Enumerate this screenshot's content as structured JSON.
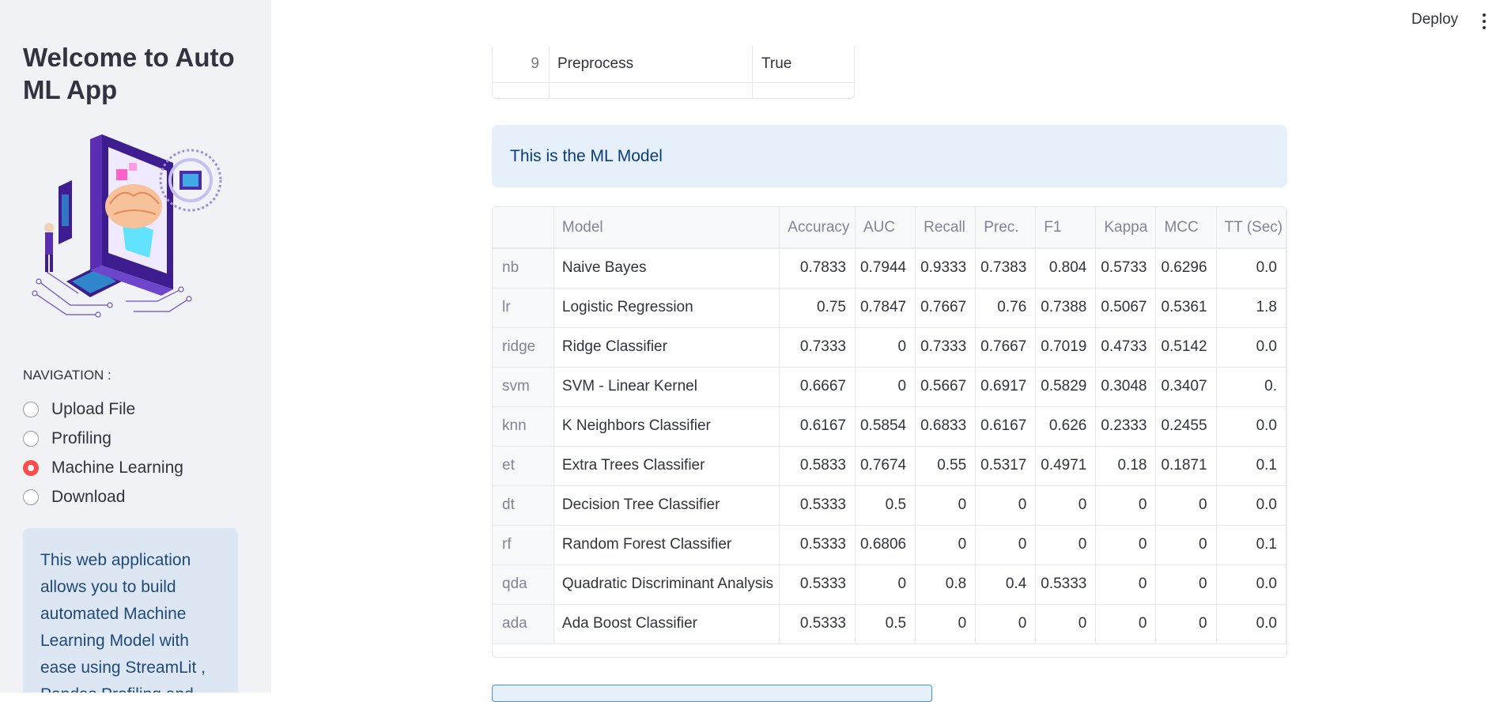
{
  "header": {
    "deploy_label": "Deploy",
    "menu_icon": "kebab-menu-icon"
  },
  "sidebar": {
    "title": "Welcome to Auto ML App",
    "nav_label": "NAVIGATION :",
    "options": [
      {
        "label": "Upload File",
        "selected": false
      },
      {
        "label": "Profiling",
        "selected": false
      },
      {
        "label": "Machine Learning",
        "selected": true
      },
      {
        "label": "Download",
        "selected": false
      }
    ],
    "info_text": "This web application allows you to build automated Machine Learning Model with ease using StreamLit , Pandas Profiling and PyCaret.",
    "accent_color": "#ff4b4b"
  },
  "setup_table": {
    "rows": [
      {
        "index": "9",
        "name": "Preprocess",
        "value": "True"
      }
    ]
  },
  "ml_banner": {
    "text": "This is the ML Model"
  },
  "model_table": {
    "columns": [
      "",
      "Model",
      "Accuracy",
      "AUC",
      "Recall",
      "Prec.",
      "F1",
      "Kappa",
      "MCC",
      "TT (Sec)"
    ],
    "rows": [
      [
        "nb",
        "Naive Bayes",
        "0.7833",
        "0.7944",
        "0.9333",
        "0.7383",
        "0.804",
        "0.5733",
        "0.6296",
        "0.0"
      ],
      [
        "lr",
        "Logistic Regression",
        "0.75",
        "0.7847",
        "0.7667",
        "0.76",
        "0.7388",
        "0.5067",
        "0.5361",
        "1.8"
      ],
      [
        "ridge",
        "Ridge Classifier",
        "0.7333",
        "0",
        "0.7333",
        "0.7667",
        "0.7019",
        "0.4733",
        "0.5142",
        "0.0"
      ],
      [
        "svm",
        "SVM - Linear Kernel",
        "0.6667",
        "0",
        "0.5667",
        "0.6917",
        "0.5829",
        "0.3048",
        "0.3407",
        "0."
      ],
      [
        "knn",
        "K Neighbors Classifier",
        "0.6167",
        "0.5854",
        "0.6833",
        "0.6167",
        "0.626",
        "0.2333",
        "0.2455",
        "0.0"
      ],
      [
        "et",
        "Extra Trees Classifier",
        "0.5833",
        "0.7674",
        "0.55",
        "0.5317",
        "0.4971",
        "0.18",
        "0.1871",
        "0.1"
      ],
      [
        "dt",
        "Decision Tree Classifier",
        "0.5333",
        "0.5",
        "0",
        "0",
        "0",
        "0",
        "0",
        "0.0"
      ],
      [
        "rf",
        "Random Forest Classifier",
        "0.5333",
        "0.6806",
        "0",
        "0",
        "0",
        "0",
        "0",
        "0.1"
      ],
      [
        "qda",
        "Quadratic Discriminant Analysis",
        "0.5333",
        "0",
        "0.8",
        "0.4",
        "0.5333",
        "0",
        "0",
        "0.0"
      ],
      [
        "ada",
        "Ada Boost Classifier",
        "0.5333",
        "0.5",
        "0",
        "0",
        "0",
        "0",
        "0",
        "0.0"
      ]
    ]
  }
}
